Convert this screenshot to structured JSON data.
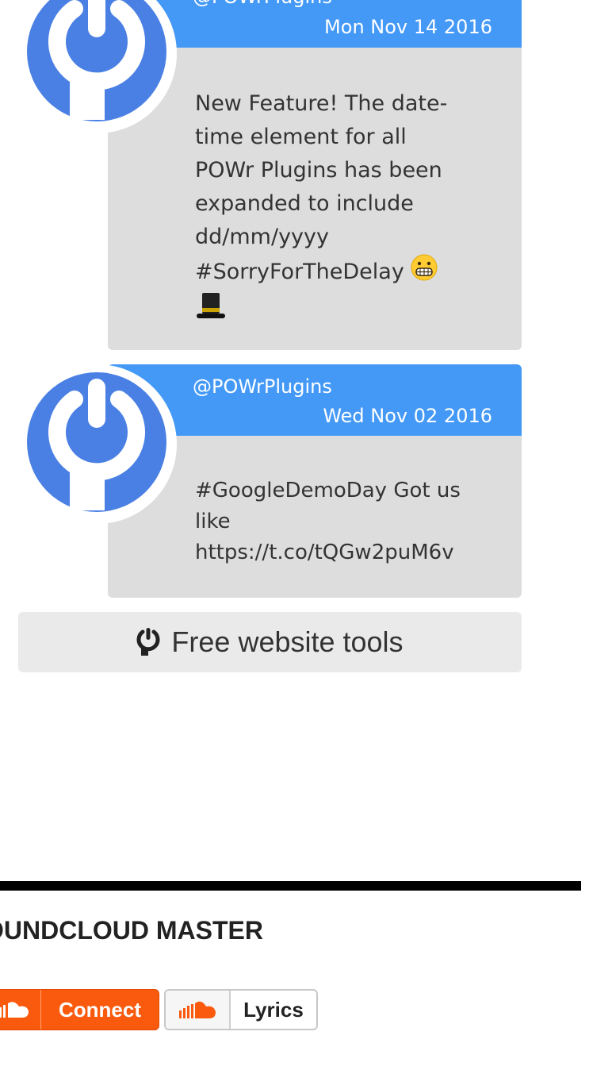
{
  "tweets": [
    {
      "handle": "@POWrPlugins",
      "date": "Mon Nov 14 2016",
      "text_lines": [
        "New Feature! The date-",
        "time element for all",
        "POWr Plugins has been",
        "expanded to include",
        "dd/mm/yyyy",
        "#SorryForTheDelay"
      ],
      "emojis": [
        "grimacing-face-emoji",
        "top-hat-emoji"
      ]
    },
    {
      "handle": "@POWrPlugins",
      "date": "Wed Nov 02 2016",
      "text_lines": [
        "#GoogleDemoDay Got us",
        "like",
        "https://t.co/tQGw2puM6v"
      ]
    }
  ],
  "tools_button": {
    "label": "Free website tools",
    "icon": "powr-plug-icon"
  },
  "widget": {
    "title": "OUNDCLOUD MASTER",
    "connect_label": "Connect",
    "lyrics_label": "Lyrics",
    "icon": "soundcloud-icon"
  },
  "colors": {
    "tweet_header": "#4499f7",
    "tweet_body": "#dddddd",
    "avatar_blue": "#4a80e4",
    "soundcloud_orange": "#fa5a0d"
  }
}
